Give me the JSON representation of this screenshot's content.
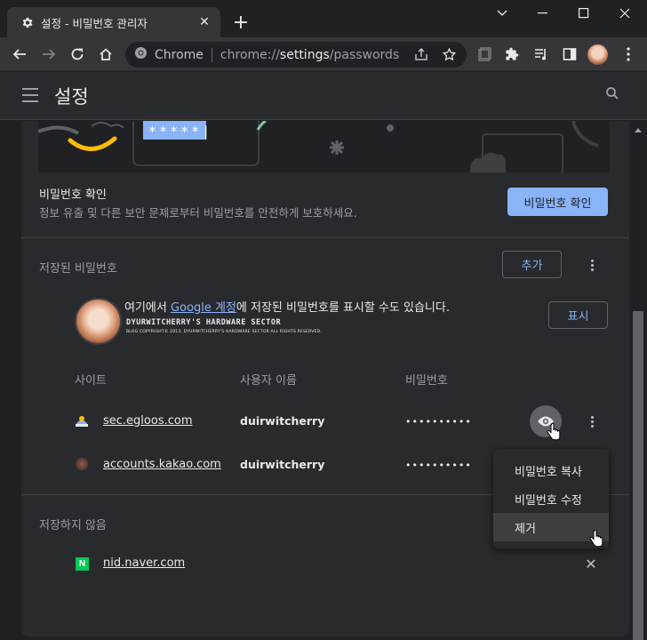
{
  "window": {
    "tab_title": "설정 - 비밀번호 관리자",
    "tab_close": "✕",
    "new_tab": "+"
  },
  "toolbar": {
    "site_label": "Chrome",
    "url_prefix": "chrome://",
    "url_host": "settings",
    "url_path": "/passwords"
  },
  "header": {
    "title": "설정"
  },
  "banner": {
    "masked_password": "*****|"
  },
  "check": {
    "title": "비밀번호 확인",
    "subtitle": "정보 유출 및 다른 보안 문제로부터 비밀번호를 안전하게 보호하세요.",
    "button": "비밀번호 확인"
  },
  "saved": {
    "title": "저장된 비밀번호",
    "add_button": "추가",
    "account_message_before": "여기에서 ",
    "account_link": "Google 계정",
    "account_message_after": "에 저장된 비밀번호를 표시할 수도 있습니다.",
    "show_button": "표시",
    "signature_line": "DYURWITCHERRY'S HARDWARE SECTOR",
    "signature_small": "BLOG COPYRIGHT© 2013, DYURWITCHERRY'S HARDWARE SECTOR ALL RIGHTS RESERVED."
  },
  "columns": {
    "site": "사이트",
    "username": "사용자 이름",
    "password": "비밀번호"
  },
  "rows": [
    {
      "site": "sec.egloos.com",
      "username": "duirwitcherry",
      "password": "••••••••••"
    },
    {
      "site": "accounts.kakao.com",
      "username": "duirwitcherry",
      "password": "••••••••••"
    }
  ],
  "never": {
    "title": "저장하지 않음",
    "site": "nid.naver.com",
    "icon_letter": "N",
    "remove": "✕"
  },
  "menu": {
    "items": [
      "비밀번호 복사",
      "비밀번호 수정",
      "제거"
    ],
    "active_index": 2
  },
  "colors": {
    "accent": "#8ab4f8",
    "surface": "#292a2d",
    "background": "#202124",
    "naver_green": "#03c75a"
  }
}
